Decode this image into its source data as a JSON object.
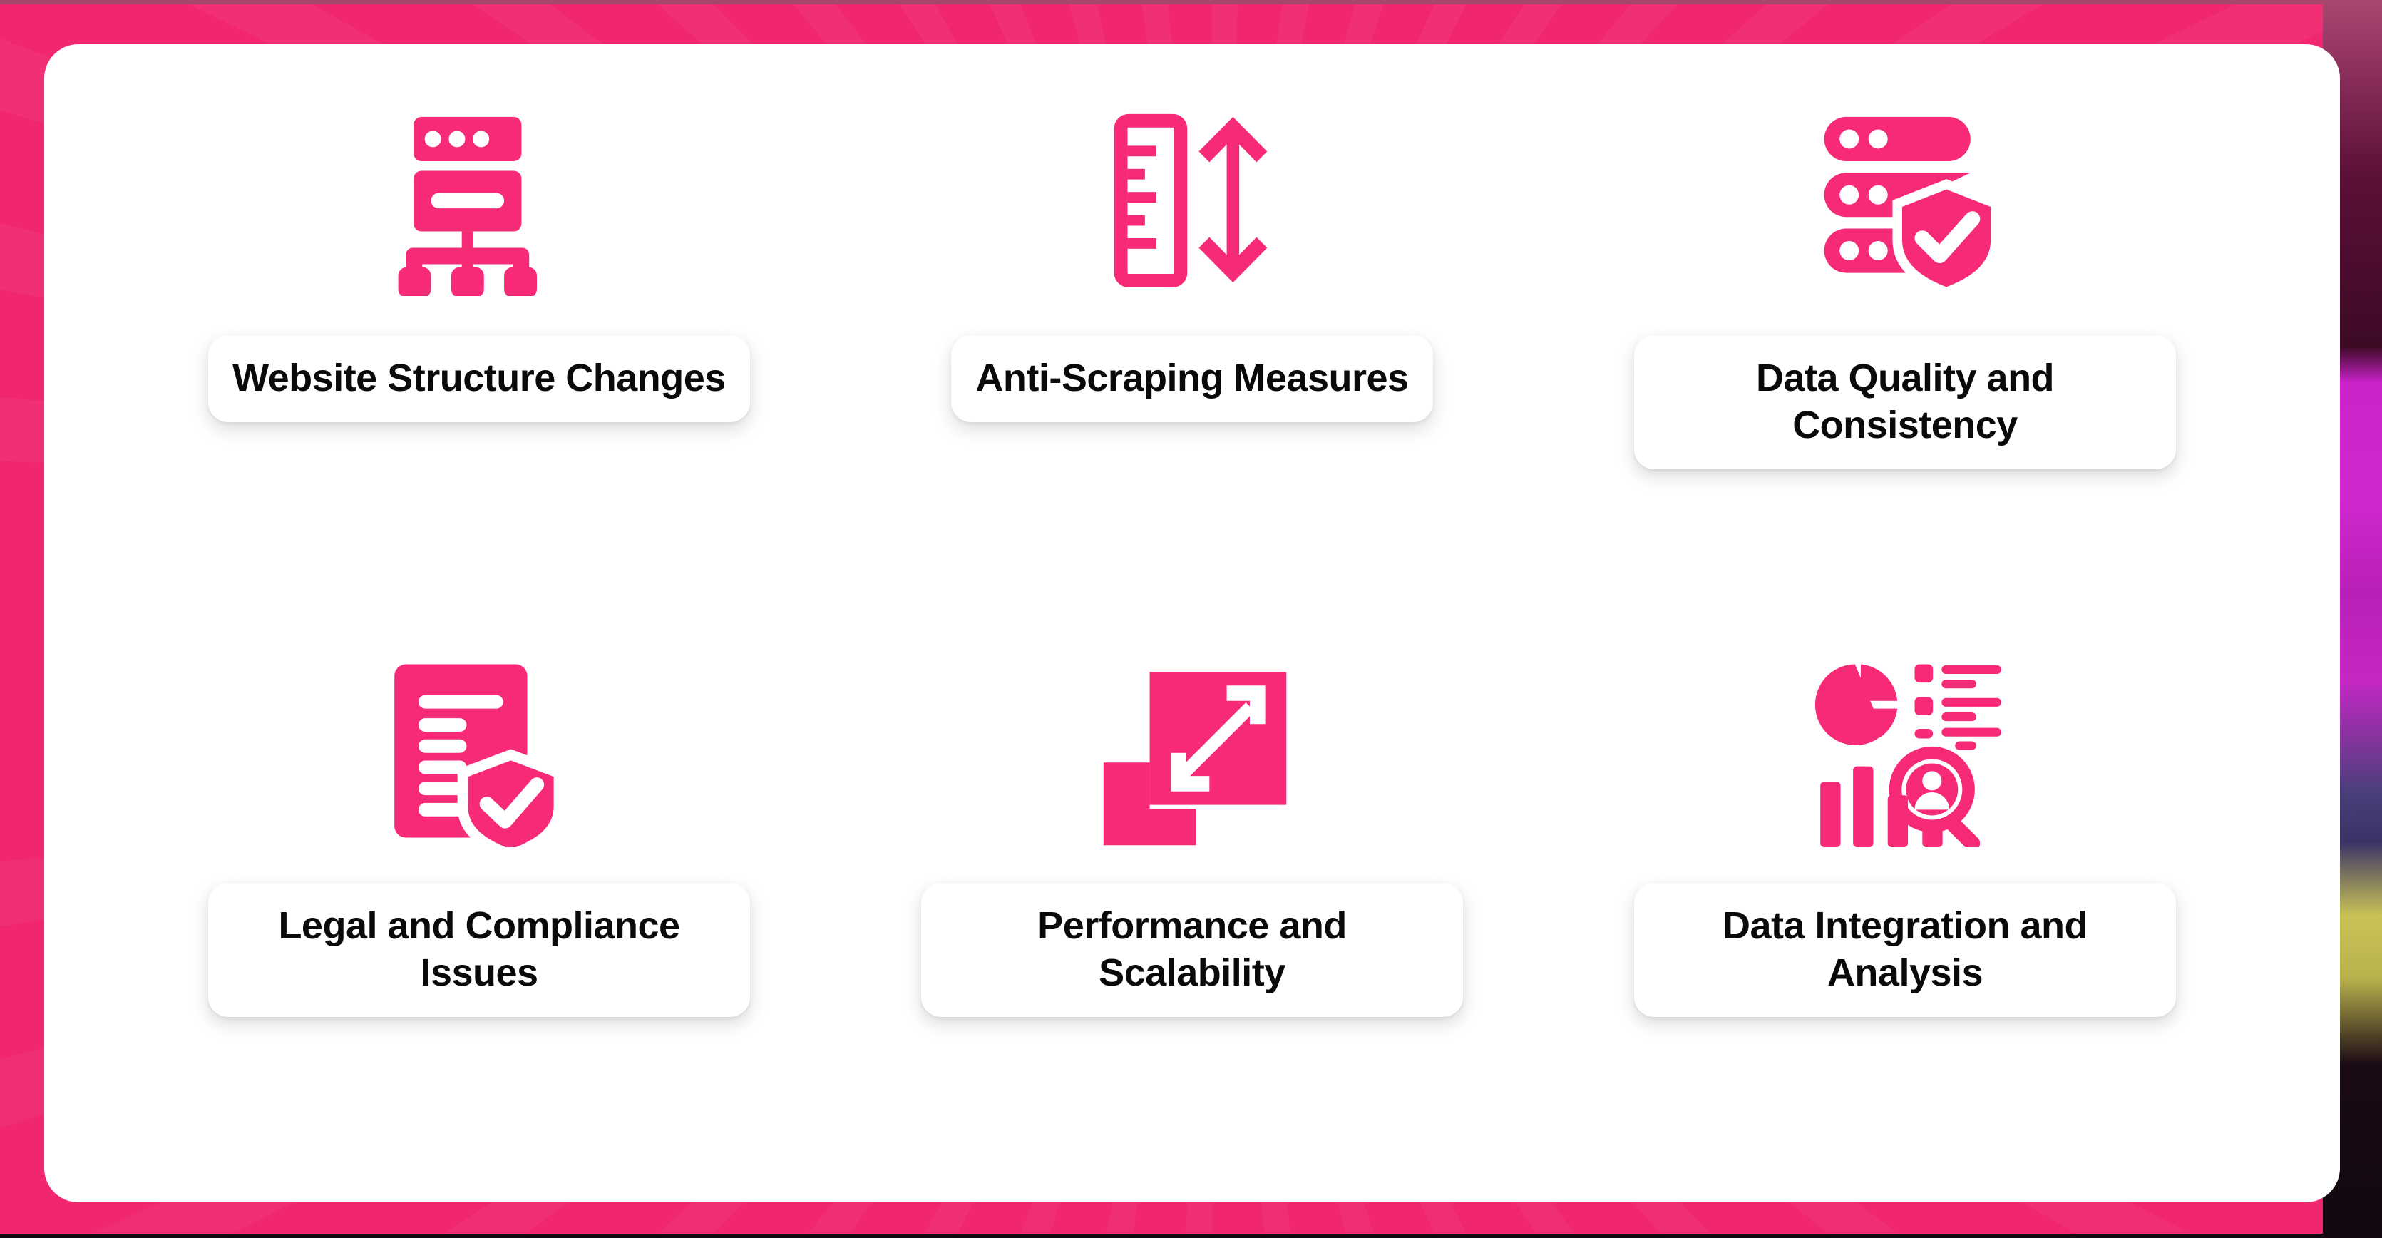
{
  "slide": {
    "layout": "2x3-icon-grid",
    "frame_color": "#f0266f",
    "card_color": "#ffffff",
    "icon_color": "#f72a77",
    "label_text_color": "#0a0a0a"
  },
  "items": [
    {
      "id": "website-structure-changes",
      "label": "Website Structure Changes",
      "icon": "sitemap-website-structure-icon"
    },
    {
      "id": "anti-scraping-measures",
      "label": "Anti-Scraping Measures",
      "icon": "ruler-vertical-arrow-icon"
    },
    {
      "id": "data-quality-and-consistency",
      "label": "Data Quality and Consistency",
      "icon": "database-shield-check-icon"
    },
    {
      "id": "legal-and-compliance-issues",
      "label": "Legal and Compliance Issues",
      "icon": "document-shield-check-icon"
    },
    {
      "id": "performance-and-scalability",
      "label": "Performance and Scalability",
      "icon": "expand-scale-arrows-icon"
    },
    {
      "id": "data-integration-and-analysis",
      "label": "Data Integration and Analysis",
      "icon": "analytics-chart-magnifier-person-icon"
    }
  ]
}
